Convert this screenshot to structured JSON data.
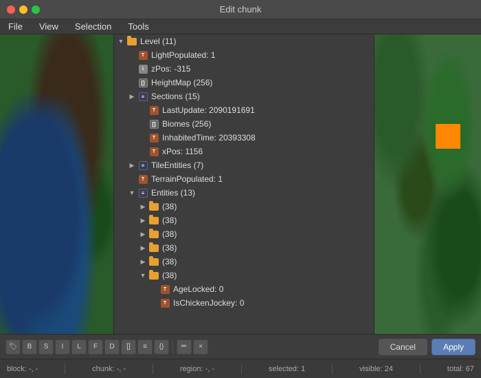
{
  "window": {
    "title": "Edit chunk",
    "traffic_lights": [
      "close",
      "minimize",
      "maximize"
    ]
  },
  "menubar": {
    "items": [
      {
        "label": "File"
      },
      {
        "label": "View"
      },
      {
        "label": "Selection"
      },
      {
        "label": "Tools"
      }
    ]
  },
  "tree": {
    "root": {
      "label": "Level (11)",
      "expanded": true,
      "children": [
        {
          "type": "byte",
          "label": "LightPopulated: 1"
        },
        {
          "type": "int",
          "label": "zPos: -315"
        },
        {
          "type": "array",
          "label": "HeightMap (256)"
        },
        {
          "type": "list",
          "label": "Sections (15)",
          "expandable": true,
          "children": [
            {
              "type": "byte",
              "label": "LastUpdate: 2090191691"
            },
            {
              "type": "array",
              "label": "Biomes (256)"
            },
            {
              "type": "byte",
              "label": "InhabitedTime: 20393308"
            },
            {
              "type": "byte",
              "label": "xPos: 1156"
            }
          ]
        },
        {
          "type": "list",
          "label": "TileEntities (7)",
          "expandable": true
        },
        {
          "type": "byte",
          "label": "TerrainPopulated: 1"
        },
        {
          "type": "folder",
          "label": "Entities (13)",
          "expandable": true,
          "expanded": true,
          "children": [
            {
              "type": "folder",
              "label": "(38)",
              "expandable": true
            },
            {
              "type": "folder",
              "label": "(38)",
              "expandable": true
            },
            {
              "type": "folder",
              "label": "(38)",
              "expandable": true
            },
            {
              "type": "folder",
              "label": "(38)",
              "expandable": true
            },
            {
              "type": "folder",
              "label": "(38)",
              "expandable": true
            },
            {
              "type": "folder",
              "label": "(38)",
              "expandable": true,
              "expanded": true,
              "children": [
                {
                  "type": "byte",
                  "label": "AgeLocked: 0"
                },
                {
                  "type": "byte",
                  "label": "IsChickenJockey: 0"
                }
              ]
            }
          ]
        }
      ]
    }
  },
  "toolbar": {
    "buttons": [
      {
        "label": "🏷",
        "name": "add-tag-btn"
      },
      {
        "label": "⬜",
        "name": "add-byte-btn"
      },
      {
        "label": "🔢",
        "name": "add-short-btn"
      },
      {
        "label": "📊",
        "name": "add-int-btn"
      },
      {
        "label": "🔷",
        "name": "add-long-btn"
      },
      {
        "label": "≈",
        "name": "add-float-btn"
      },
      {
        "label": "≋",
        "name": "add-double-btn"
      },
      {
        "label": "[]",
        "name": "add-array-btn"
      },
      {
        "label": "≡",
        "name": "add-list-btn"
      },
      {
        "label": "{}",
        "name": "add-compound-btn"
      },
      {
        "label": "✏",
        "name": "edit-btn"
      },
      {
        "label": "×",
        "name": "delete-btn"
      }
    ]
  },
  "buttons": {
    "cancel": "Cancel",
    "apply": "Apply"
  },
  "statusbar": {
    "block": "block: -, -",
    "chunk": "chunk: -, -",
    "region": "region: -, -",
    "selected": "selected: 1",
    "visible": "visible: 24",
    "total": "total: 67"
  }
}
